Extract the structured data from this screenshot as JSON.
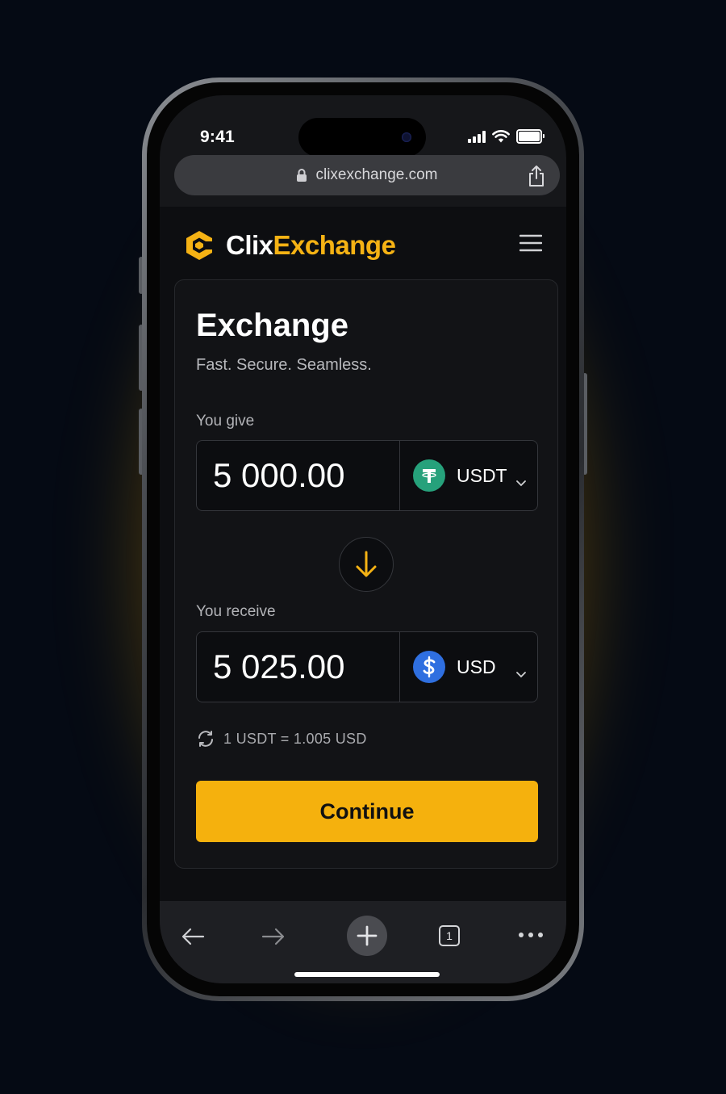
{
  "status": {
    "time": "9:41"
  },
  "browser": {
    "url": "clixexchange.com"
  },
  "brand": {
    "name_part1": "Clix",
    "name_part2": "Exchange",
    "accent_color": "#f5b214"
  },
  "exchange": {
    "title": "Exchange",
    "subtitle": "Fast. Secure. Seamless.",
    "give": {
      "label": "You give",
      "amount": "5 000.00",
      "currency": "USDT",
      "coin_icon": "tether-icon",
      "coin_color": "#26a17b"
    },
    "receive": {
      "label": "You receive",
      "amount": "5 025.00",
      "currency": "USD",
      "coin_icon": "dollar-coin-icon",
      "coin_color": "#2f6fe0"
    },
    "rate": "1 USDT = 1.005 USD",
    "continue_label": "Continue",
    "button_color": "#f5b10d"
  },
  "toolbar": {
    "tab_count": "1"
  }
}
